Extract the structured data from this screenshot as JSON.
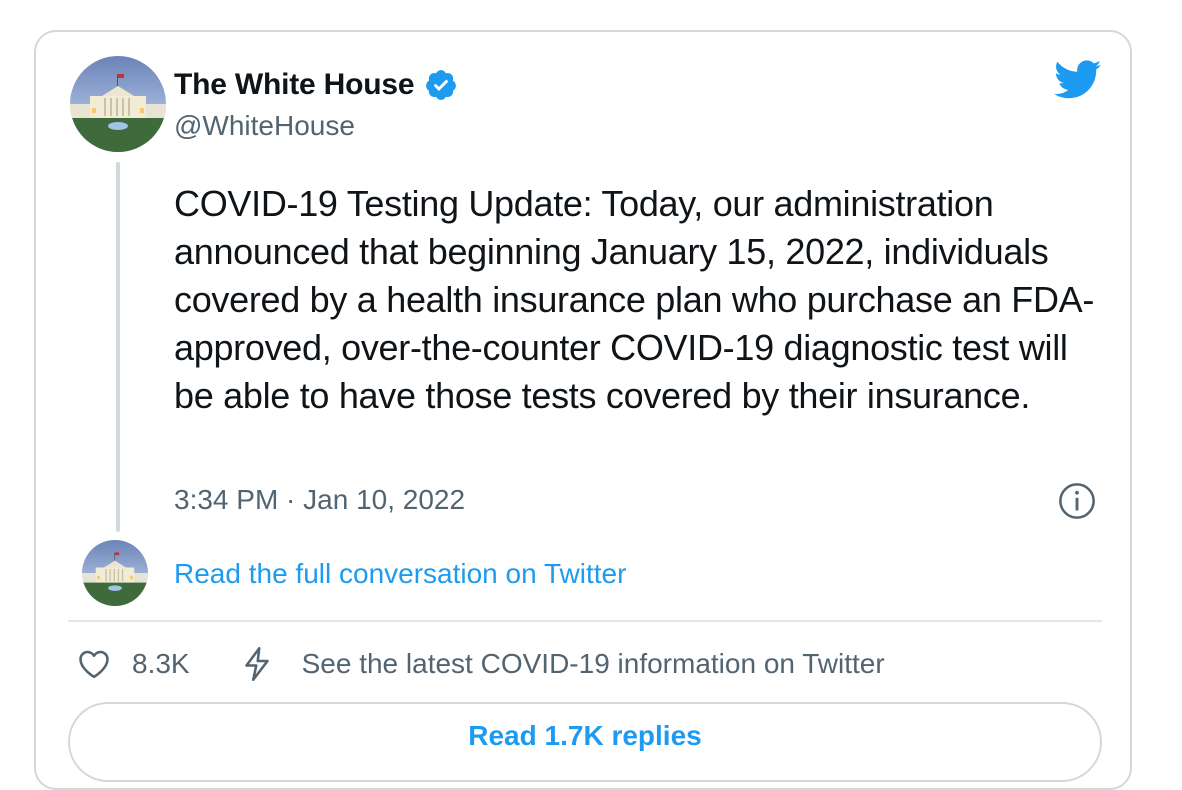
{
  "author": {
    "display_name": "The White House",
    "handle": "@WhiteHouse",
    "verified": true
  },
  "tweet": {
    "text": "COVID-19 Testing Update: Today, our administration announced that beginning January 15, 2022, individuals covered by a health insurance plan who purchase an FDA-approved, over-the-counter COVID-19 diagnostic test will be able to have those tests covered by their insurance.",
    "timestamp": "3:34 PM · Jan 10, 2022"
  },
  "links": {
    "read_conversation": "Read the full conversation on Twitter",
    "covid_info": "See the latest COVID-19 information on Twitter",
    "read_replies": "Read 1.7K replies"
  },
  "stats": {
    "likes": "8.3K"
  },
  "icons": {
    "brand": "twitter-bird-icon",
    "verified": "verified-badge-icon",
    "info": "info-icon",
    "like": "heart-icon",
    "covid": "lightning-bolt-icon"
  },
  "colors": {
    "accent": "#1d9bf0",
    "text": "#0f1419",
    "muted": "#536471",
    "border": "#cfd9de"
  }
}
